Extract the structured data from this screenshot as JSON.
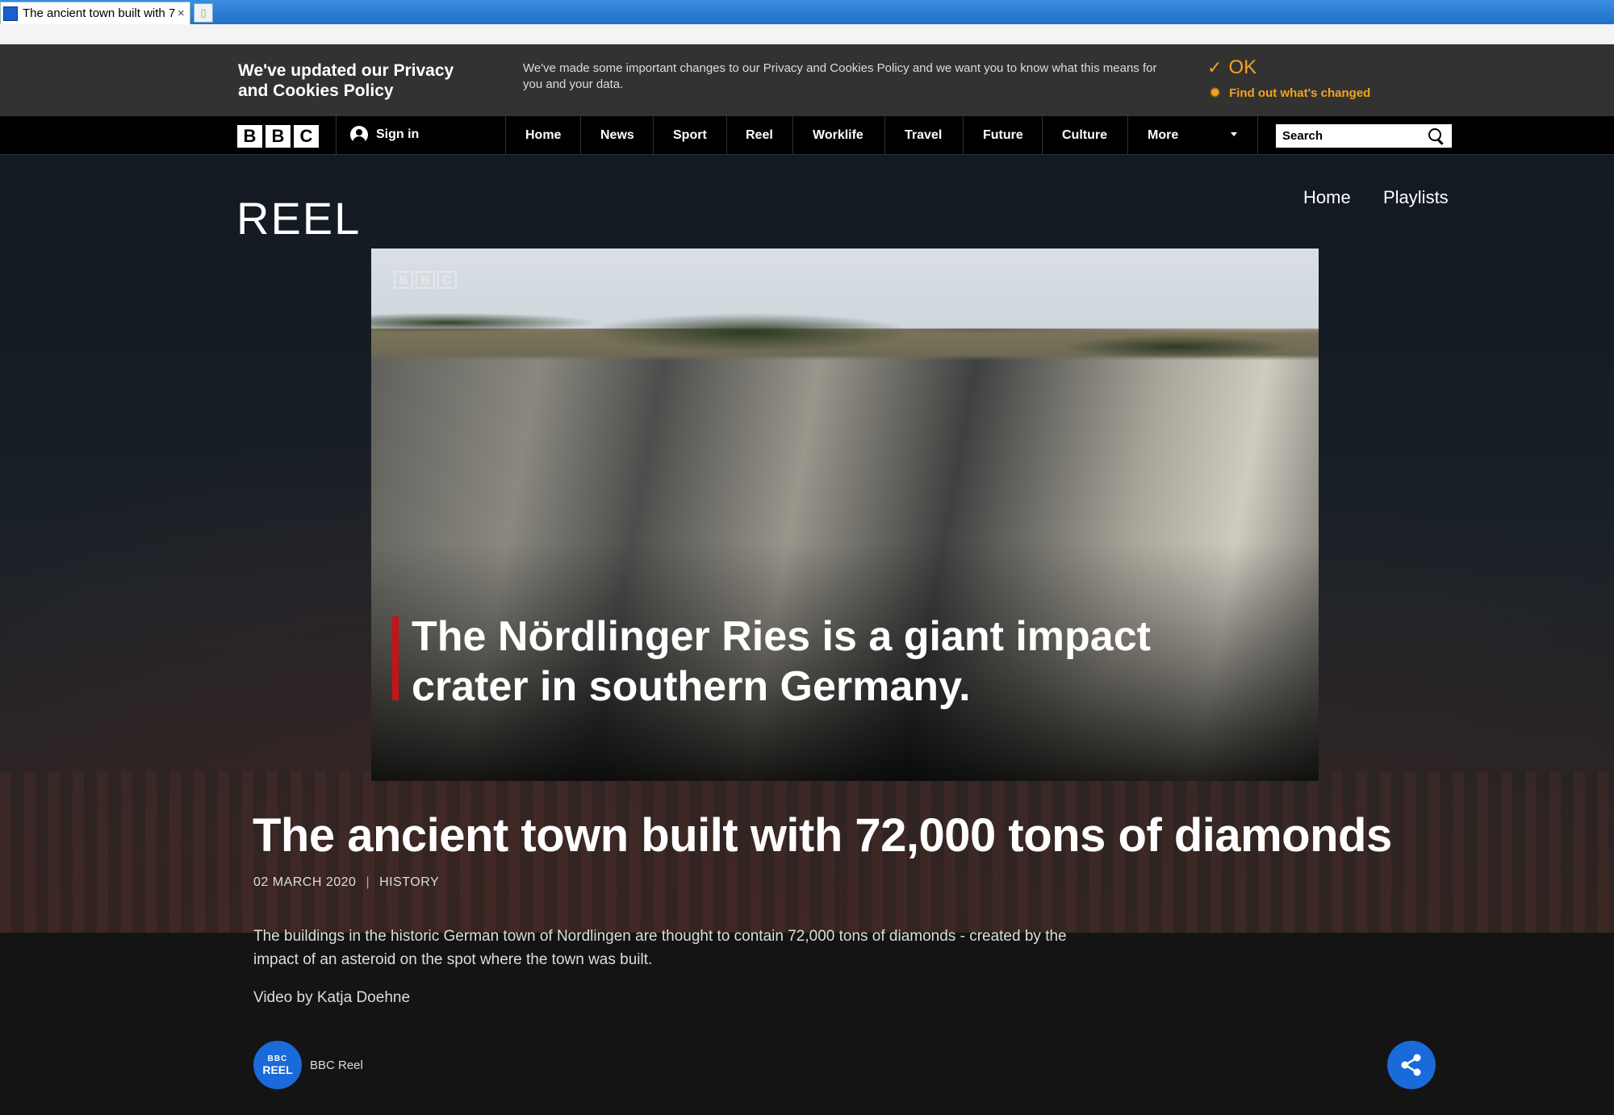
{
  "browser": {
    "tab_title": "The ancient town built with 7...",
    "tab_close": "×"
  },
  "privacy": {
    "title": "We've updated our Privacy and Cookies Policy",
    "text": "We've made some important changes to our Privacy and Cookies Policy and we want you to know what this means for you and your data.",
    "ok_label": "OK",
    "more_label": "Find out what's changed"
  },
  "nav": {
    "logo": [
      "B",
      "B",
      "C"
    ],
    "signin": "Sign in",
    "links": [
      "Home",
      "News",
      "Sport",
      "Reel",
      "Worklife",
      "Travel",
      "Future",
      "Culture",
      "More"
    ],
    "search_label": "Search"
  },
  "reel": {
    "logo": "REEL",
    "home": "Home",
    "playlists": "Playlists"
  },
  "video": {
    "watermark": [
      "B",
      "B",
      "C"
    ],
    "caption": "The Nördlinger Ries is a giant impact crater in southern Germany."
  },
  "article": {
    "headline": "The ancient town built with 72,000 tons of diamonds",
    "date": "02 MARCH 2020",
    "category": "HISTORY",
    "description": "The buildings in the historic German town of Nordlingen are thought to contain 72,000 tons of diamonds - created by the impact of an asteroid on the spot where the town was built.",
    "byline": "Video by Katja Doehne",
    "channel_badge_top": "BBC",
    "channel_badge_bottom": "REEL",
    "channel_name": "BBC Reel"
  },
  "colors": {
    "accent": "#f6a21d",
    "share": "#1a6ad9",
    "caption_bar": "#c4131a"
  }
}
